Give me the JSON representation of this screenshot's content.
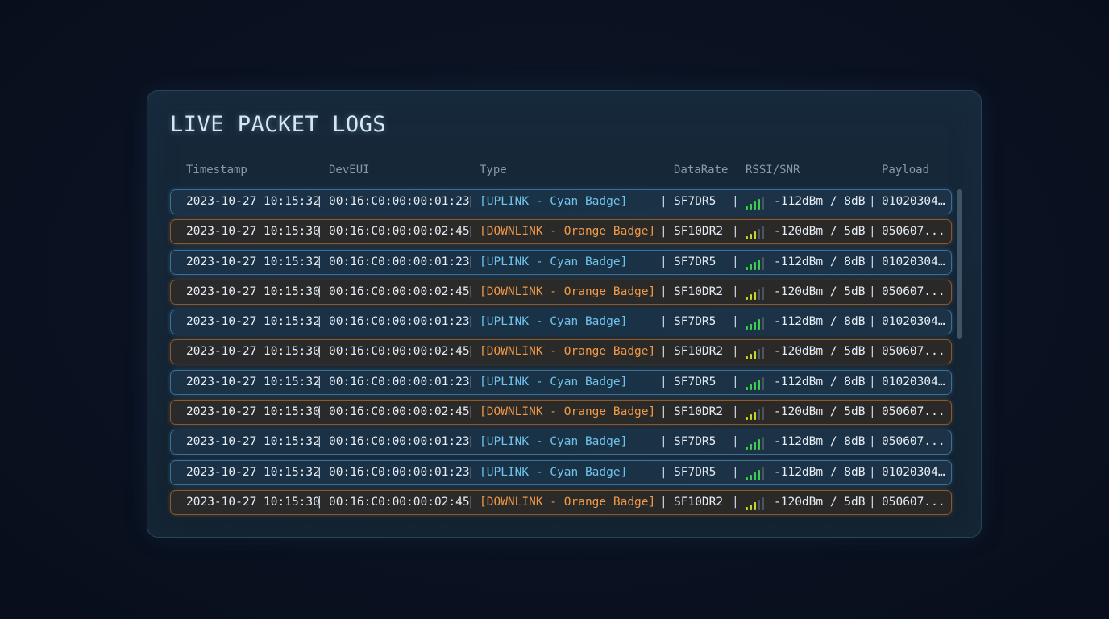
{
  "title": "LIVE PACKET LOGS",
  "columns": [
    "Timestamp",
    "DevEUI",
    "Type",
    "DataRate",
    "RSSI/SNR",
    "Payload"
  ],
  "separator": "|",
  "colors": {
    "uplink": "#6ec4ec",
    "downlink": "#f09a48",
    "signal_good": "#3ccf4e",
    "signal_mid": "#c8d62a"
  },
  "signal_icon": "signal-bars-icon",
  "rows": [
    {
      "kind": "up",
      "timestamp": "2023-10-27 10:15:32",
      "deveui": "00:16:C0:00:00:01:23",
      "type": "[UPLINK - Cyan Badge]",
      "datarate": "SF7DR5",
      "rssi_snr": "-112dBm / 8dB",
      "payload": "01020304…",
      "signal_level": 4
    },
    {
      "kind": "down",
      "timestamp": "2023-10-27 10:15:30",
      "deveui": "00:16:C0:00:00:02:45",
      "type": "[DOWNLINK - Orange Badge]",
      "datarate": "SF10DR2",
      "rssi_snr": "-120dBm / 5dB",
      "payload": "050607...",
      "signal_level": 3
    },
    {
      "kind": "up",
      "timestamp": "2023-10-27 10:15:32",
      "deveui": "00:16:C0:00:00:01:23",
      "type": "[UPLINK - Cyan Badge]",
      "datarate": "SF7DR5",
      "rssi_snr": "-112dBm / 8dB",
      "payload": "01020304…",
      "signal_level": 4
    },
    {
      "kind": "down",
      "timestamp": "2023-10-27 10:15:30",
      "deveui": "00:16:C0:00:00:02:45",
      "type": "[DOWNLINK - Orange Badge]",
      "datarate": "SF10DR2",
      "rssi_snr": "-120dBm / 5dB",
      "payload": "050607...",
      "signal_level": 3
    },
    {
      "kind": "up",
      "timestamp": "2023-10-27 10:15:32",
      "deveui": "00:16:C0:00:00:01:23",
      "type": "[UPLINK - Cyan Badge]",
      "datarate": "SF7DR5",
      "rssi_snr": "-112dBm / 8dB",
      "payload": "01020304…",
      "signal_level": 4
    },
    {
      "kind": "down",
      "timestamp": "2023-10-27 10:15:30",
      "deveui": "00:16:C0:00:00:02:45",
      "type": "[DOWNLINK - Orange Badge]",
      "datarate": "SF10DR2",
      "rssi_snr": "-120dBm / 5dB",
      "payload": "050607...",
      "signal_level": 3
    },
    {
      "kind": "up",
      "timestamp": "2023-10-27 10:15:32",
      "deveui": "00:16:C0:00:00:01:23",
      "type": "[UPLINK - Cyan Badge]",
      "datarate": "SF7DR5",
      "rssi_snr": "-112dBm / 8dB",
      "payload": "01020304…",
      "signal_level": 4
    },
    {
      "kind": "down",
      "timestamp": "2023-10-27 10:15:30",
      "deveui": "00:16:C0:00:00:02:45",
      "type": "[DOWNLINK - Orange Badge]",
      "datarate": "SF10DR2",
      "rssi_snr": "-120dBm / 5dB",
      "payload": "050607...",
      "signal_level": 3
    },
    {
      "kind": "up",
      "timestamp": "2023-10-27 10:15:32",
      "deveui": "00:16:C0:00:00:01:23",
      "type": "[UPLINK - Cyan Badge]",
      "datarate": "SF7DR5",
      "rssi_snr": "-112dBm / 8dB",
      "payload": "050607...",
      "signal_level": 4
    },
    {
      "kind": "up",
      "timestamp": "2023-10-27 10:15:32",
      "deveui": "00:16:C0:00:00:01:23",
      "type": "[UPLINK - Cyan Badge]",
      "datarate": "SF7DR5",
      "rssi_snr": "-112dBm / 8dB",
      "payload": "01020304…",
      "signal_level": 4
    },
    {
      "kind": "down",
      "timestamp": "2023-10-27 10:15:30",
      "deveui": "00:16:C0:00:00:02:45",
      "type": "[DOWNLINK - Orange Badge]",
      "datarate": "SF10DR2",
      "rssi_snr": "-120dBm / 5dB",
      "payload": "050607...",
      "signal_level": 3
    }
  ]
}
